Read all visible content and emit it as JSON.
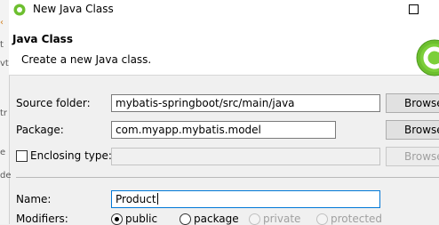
{
  "window": {
    "title": "New Java Class"
  },
  "banner": {
    "title": "Java Class",
    "message": "Create a new Java class."
  },
  "background_fragments": [
    "‹",
    "t",
    "vt",
    "tr",
    "e",
    "de"
  ],
  "form": {
    "source_folder": {
      "label": "Source folder:",
      "value": "mybatis-springboot/src/main/java",
      "button": "Browse..."
    },
    "package": {
      "label": "Package:",
      "value": "com.myapp.mybatis.model",
      "button": "Browse..."
    },
    "enclosing_type": {
      "label": "Enclosing type:",
      "value": "",
      "button": "Browse...",
      "checked": false
    },
    "name": {
      "label": "Name:",
      "value": "Product"
    },
    "modifiers": {
      "label": "Modifiers:",
      "options": [
        "public",
        "package",
        "private",
        "protected"
      ],
      "selected": "public"
    }
  },
  "colors": {
    "accent_green": "#6dbf2f",
    "focus_blue": "#0078d7"
  }
}
